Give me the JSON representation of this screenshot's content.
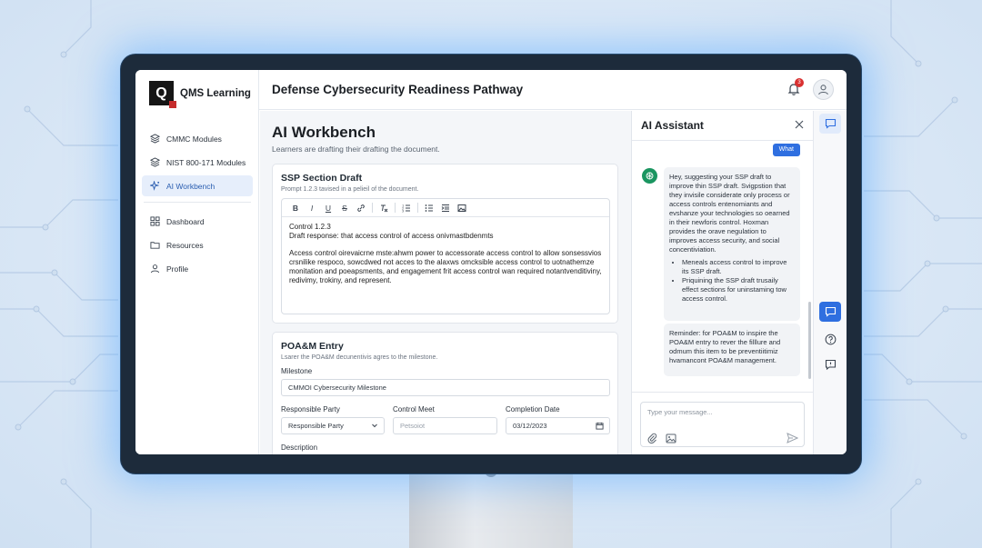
{
  "app": {
    "logo_letter": "Q",
    "name": "QMS Learning"
  },
  "sidebar": {
    "items": [
      {
        "label": "CMMC Modules",
        "icon": "layers-icon"
      },
      {
        "label": "NIST 800-171 Modules",
        "icon": "layers-icon"
      },
      {
        "label": "AI Workbench",
        "icon": "sparkle-icon",
        "active": true
      },
      {
        "label": "Dashboard",
        "icon": "grid-icon"
      },
      {
        "label": "Resources",
        "icon": "folder-icon"
      },
      {
        "label": "Profile",
        "icon": "user-icon"
      }
    ]
  },
  "header": {
    "title": "Defense Cybersecurity Readiness Pathway",
    "notification_count": "3"
  },
  "main": {
    "title": "AI Workbench",
    "subtitle": "Learners are drafting their drafting the document.",
    "ssp": {
      "title": "SSP Section Draft",
      "subtitle": "Prompt 1.2.3 tavised in a pelieil of the document.",
      "toolbar": [
        "B",
        "I",
        "U",
        "S",
        "link",
        "clear",
        "ordered-list",
        "bullet-list",
        "indent",
        "image"
      ],
      "body_line1": "Control 1.2.3",
      "body_line2": "Draft response: that access control of access onivmastbdenmts",
      "body_para": "Access control oirevaicrne mste:ahwm power to accessorate access control to allow sonsessvios crsnilike respoco, sowcdwed not acces to the alaxws omcksible access control to uotnathemze monitation and poeapsments, and engagement frit access control wan required notantvenditiviny, redivimy, trokiny, and represent."
    },
    "poam": {
      "title": "POA&M Entry",
      "subtitle": "Lsarer the POA&M decunentivis agres to the milestone.",
      "milestone_label": "Milestone",
      "milestone_value": "CMMOI Cybersecurity Milestone",
      "responsible_label": "Responsible Party",
      "responsible_value": "Responsible Party",
      "control_label": "Control Meet",
      "control_placeholder": "Petsoiot",
      "completion_label": "Completion Date",
      "completion_value": "03/12/2023",
      "description_label": "Description"
    }
  },
  "assistant": {
    "title": "AI Assistant",
    "chip": "What",
    "message1_intro": "Hey, suggesting your SSP draft to improve thin SSP draft. Svigpstion that they invisile considerate only process or access controls entenomiants and evshanze your technologies so oearned in their newforis control. Hoxman provides the orave negulation to improves access security, and social concentiviation.",
    "message1_bullets": [
      "Meneals access control to improve its SSP draft.",
      "Priquining the SSP draft trusaily effect sections for uninstaming tow access control."
    ],
    "message2": "Reminder: for POA&M to inspire the POA&M entry to rever the filllure and odmum this item to be preventiitimiz hvamancont POA&M management.",
    "input_placeholder": "Type your message..."
  },
  "colors": {
    "accent": "#2f6fe0",
    "active_nav_bg": "#e6eefb",
    "bot_avatar": "#1a9560",
    "badge": "#d93030"
  }
}
